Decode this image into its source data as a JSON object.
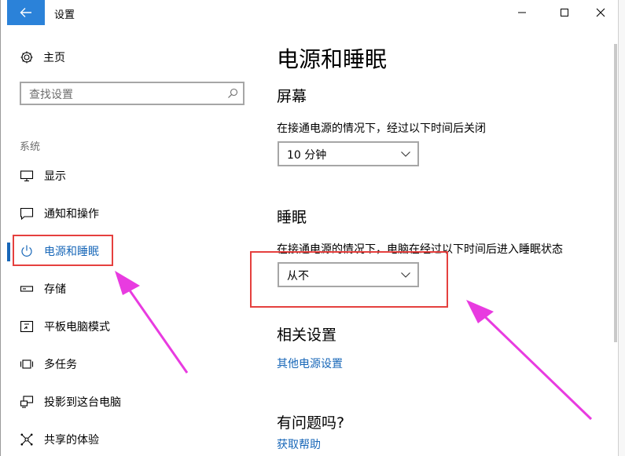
{
  "window": {
    "title": "设置",
    "min_glyph": "─",
    "max_glyph": "☐",
    "close_glyph": "✕"
  },
  "sidebar": {
    "home_label": "主页",
    "search_placeholder": "查找设置",
    "section_label": "系统",
    "items": [
      {
        "label": "显示",
        "icon": "monitor-icon"
      },
      {
        "label": "通知和操作",
        "icon": "notification-icon"
      },
      {
        "label": "电源和睡眠",
        "icon": "power-icon",
        "active": true
      },
      {
        "label": "存储",
        "icon": "storage-icon"
      },
      {
        "label": "平板电脑模式",
        "icon": "tablet-mode-icon"
      },
      {
        "label": "多任务",
        "icon": "multitask-icon"
      },
      {
        "label": "投影到这台电脑",
        "icon": "project-icon"
      },
      {
        "label": "共享的体验",
        "icon": "share-icon"
      }
    ]
  },
  "main": {
    "page_title": "电源和睡眠",
    "screen": {
      "heading": "屏幕",
      "description": "在接通电源的情况下，经过以下时间后关闭",
      "value": "10 分钟"
    },
    "sleep": {
      "heading": "睡眠",
      "description": "在接通电源的情况下，电脑在经过以下时间后进入睡眠状态",
      "value": "从不"
    },
    "related": {
      "heading": "相关设置",
      "link": "其他电源设置"
    },
    "help": {
      "heading": "有问题吗?",
      "link": "获取帮助"
    }
  },
  "colors": {
    "accent": "#1867b8",
    "back_button": "#2b82d9",
    "annotation_box": "#e5403e",
    "annotation_arrow": "#e83be0"
  }
}
